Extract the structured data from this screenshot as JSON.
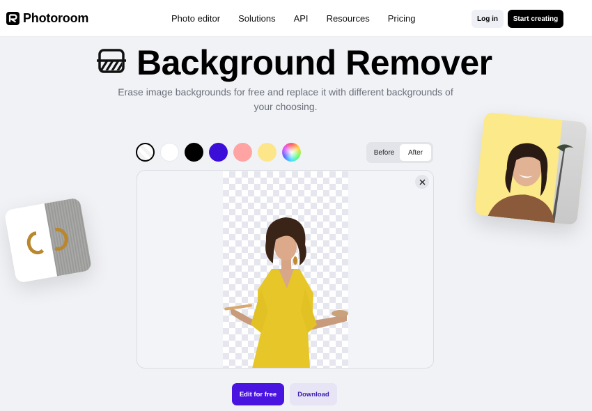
{
  "header": {
    "brand": "Photoroom",
    "nav": [
      "Photo editor",
      "Solutions",
      "API",
      "Resources",
      "Pricing"
    ],
    "login_label": "Log in",
    "cta_label": "Start creating"
  },
  "hero": {
    "icon": "background-remover-icon",
    "title": "Background Remover",
    "subtitle": "Erase image backgrounds for free and replace it with different backgrounds of your choosing."
  },
  "editor": {
    "swatches": [
      {
        "name": "transparent",
        "color": "transparent",
        "selected": true
      },
      {
        "name": "white",
        "color": "#ffffff"
      },
      {
        "name": "black",
        "color": "#000000"
      },
      {
        "name": "purple",
        "color": "#3c0fd8"
      },
      {
        "name": "pink",
        "color": "#ffa3a3"
      },
      {
        "name": "yellow",
        "color": "#fde58a"
      },
      {
        "name": "custom",
        "color": "rainbow"
      }
    ],
    "toggle": {
      "before_label": "Before",
      "after_label": "After",
      "active": "After"
    },
    "close_icon": "close-icon"
  },
  "actions": {
    "edit_label": "Edit for free",
    "download_label": "Download"
  },
  "colors": {
    "accent": "#4a14e0",
    "page_bg": "#f1f2f6"
  }
}
